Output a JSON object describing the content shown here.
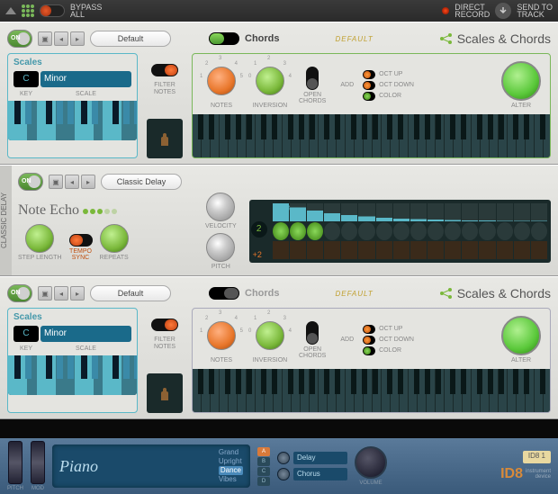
{
  "topbar": {
    "bypass_label": "BYPASS\nALL",
    "direct_record": "DIRECT\nRECORD",
    "send_to_track": "SEND TO\nTRACK"
  },
  "sc_device": {
    "patch": "Default",
    "chords_label": "Chords",
    "default_tag": "DEFAULT",
    "brand": "Scales & Chords",
    "scales_title": "Scales",
    "key": "C",
    "scale": "Minor",
    "key_label": "KEY",
    "scale_label": "SCALE",
    "filter_notes": "FILTER\nNOTES",
    "notes_label": "NOTES",
    "inversion_label": "INVERSION",
    "open_chords": "OPEN\nCHORDS",
    "add_label": "ADD",
    "oct_up": "OCT UP",
    "oct_down": "OCT DOWN",
    "color": "COLOR",
    "alter": "ALTER"
  },
  "noteecho": {
    "side_label": "CLASSIC DELAY",
    "patch": "Classic Delay",
    "brand": "Note Echo",
    "velocity": "VELOCITY",
    "pitch": "PITCH",
    "step_length": "STEP LENGTH",
    "tempo_sync": "TEMPO\nSYNC",
    "repeats": "REPEATS",
    "percent": "77%",
    "step_value": "2",
    "pitch_value": "+2",
    "vel_bars": [
      100,
      77,
      59,
      46,
      35,
      27,
      21,
      16,
      12,
      10,
      7,
      6,
      4,
      3,
      2,
      2
    ],
    "leds_on": 3,
    "pitch_bars": [
      0,
      0,
      0,
      0,
      0,
      0,
      0,
      0,
      0,
      0,
      0,
      0,
      0,
      0,
      0,
      0
    ]
  },
  "id8": {
    "pitch_label": "PITCH",
    "mod_label": "MOD",
    "category": "Piano",
    "list": [
      "Grand",
      "Upright",
      "Dance",
      "Vibes"
    ],
    "selected": "Dance",
    "slots": [
      "A",
      "B",
      "C",
      "D"
    ],
    "slot_on": "A",
    "fx1": "Delay",
    "fx2": "Chorus",
    "volume_label": "VOLUME",
    "patch_name": "ID8 1",
    "brand": "ID8",
    "sub": "instrument\ndevice"
  }
}
